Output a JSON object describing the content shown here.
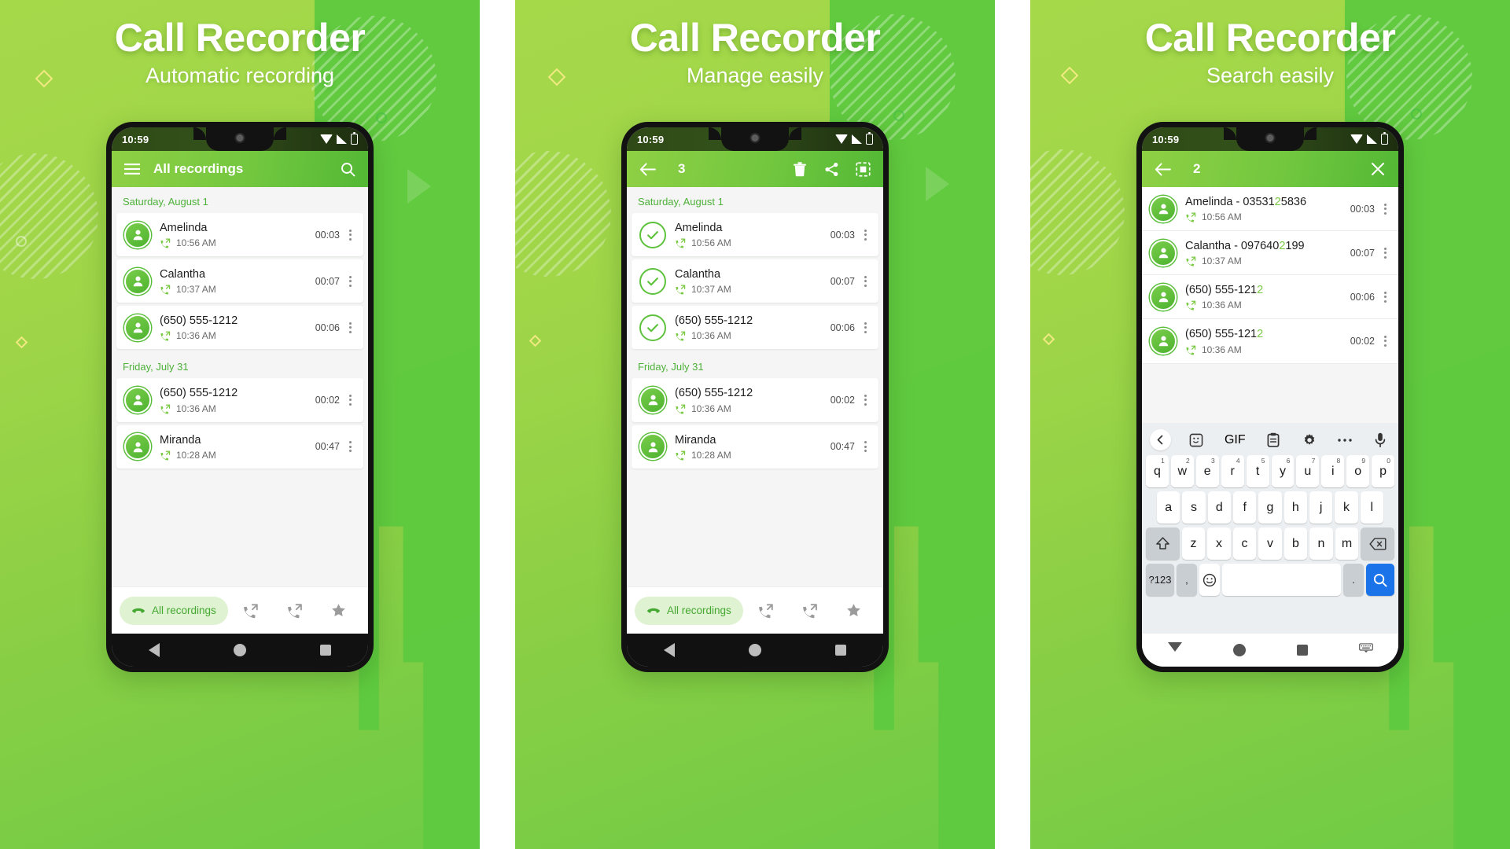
{
  "panels": [
    {
      "heading": "Call Recorder",
      "subheading": "Automatic recording",
      "status": {
        "time": "10:59"
      },
      "appbar": {
        "mode": "normal",
        "title": "All recordings",
        "menu_icon": "hamburger-icon",
        "search_icon": "search-icon"
      },
      "groups": [
        {
          "date": "Saturday, August 1",
          "items": [
            {
              "name": "Amelinda",
              "time": "10:56 AM",
              "duration": "00:03",
              "direction": "outgoing"
            },
            {
              "name": "Calantha",
              "time": "10:37 AM",
              "duration": "00:07",
              "direction": "outgoing"
            },
            {
              "name": "(650) 555-1212",
              "time": "10:36 AM",
              "duration": "00:06",
              "direction": "incoming"
            }
          ]
        },
        {
          "date": "Friday, July 31",
          "items": [
            {
              "name": "(650) 555-1212",
              "time": "10:36 AM",
              "duration": "00:02",
              "direction": "incoming"
            },
            {
              "name": "Miranda",
              "time": "10:28 AM",
              "duration": "00:47",
              "direction": "incoming"
            }
          ]
        }
      ],
      "tabbar": {
        "pill_label": "All recordings",
        "pill_icon": "phone-icon",
        "tabs": [
          "incoming-call-icon",
          "outgoing-call-icon",
          "star-icon"
        ]
      },
      "navbar": "dark"
    },
    {
      "heading": "Call Recorder",
      "subheading": "Manage easily",
      "status": {
        "time": "10:59"
      },
      "appbar": {
        "mode": "selection",
        "title": "3",
        "back_icon": "back-arrow-icon",
        "actions": [
          "delete-icon",
          "share-icon",
          "select-all-icon"
        ]
      },
      "groups": [
        {
          "date": "Saturday, August 1",
          "items": [
            {
              "name": "Amelinda",
              "time": "10:56 AM",
              "duration": "00:03",
              "direction": "outgoing",
              "selected": true
            },
            {
              "name": "Calantha",
              "time": "10:37 AM",
              "duration": "00:07",
              "direction": "outgoing",
              "selected": true
            },
            {
              "name": "(650) 555-1212",
              "time": "10:36 AM",
              "duration": "00:06",
              "direction": "incoming",
              "selected": true
            }
          ]
        },
        {
          "date": "Friday, July 31",
          "items": [
            {
              "name": "(650) 555-1212",
              "time": "10:36 AM",
              "duration": "00:02",
              "direction": "incoming",
              "selected": false
            },
            {
              "name": "Miranda",
              "time": "10:28 AM",
              "duration": "00:47",
              "direction": "incoming",
              "selected": false
            }
          ]
        }
      ],
      "tabbar": {
        "pill_label": "All recordings",
        "pill_icon": "phone-icon",
        "tabs": [
          "incoming-call-icon",
          "outgoing-call-icon",
          "star-icon"
        ]
      },
      "navbar": "dark"
    },
    {
      "heading": "Call Recorder",
      "subheading": "Search easily",
      "status": {
        "time": "10:59"
      },
      "appbar": {
        "mode": "search",
        "title": "2",
        "back_icon": "back-arrow-icon",
        "close_icon": "close-icon"
      },
      "search_query": "2",
      "results": [
        {
          "name_pre": "Amelinda - 03531",
          "name_hl": "2",
          "name_post": "5836",
          "time": "10:56 AM",
          "duration": "00:03",
          "direction": "outgoing"
        },
        {
          "name_pre": "Calantha - 097640",
          "name_hl": "2",
          "name_post": "199",
          "time": "10:37 AM",
          "duration": "00:07",
          "direction": "outgoing"
        },
        {
          "name_pre": "(650) 555-121",
          "name_hl": "2",
          "name_post": "",
          "time": "10:36 AM",
          "duration": "00:06",
          "direction": "incoming"
        },
        {
          "name_pre": "(650) 555-121",
          "name_hl": "2",
          "name_post": "",
          "time": "10:36 AM",
          "duration": "00:02",
          "direction": "incoming"
        }
      ],
      "keyboard": {
        "toolbar": [
          "chevron-left-icon",
          "sticker-icon",
          "gif-label",
          "clipboard-icon",
          "gear-icon",
          "more-icon",
          "microphone-icon"
        ],
        "gif_label": "GIF",
        "row1": [
          {
            "k": "q",
            "n": "1"
          },
          {
            "k": "w",
            "n": "2"
          },
          {
            "k": "e",
            "n": "3"
          },
          {
            "k": "r",
            "n": "4"
          },
          {
            "k": "t",
            "n": "5"
          },
          {
            "k": "y",
            "n": "6"
          },
          {
            "k": "u",
            "n": "7"
          },
          {
            "k": "i",
            "n": "8"
          },
          {
            "k": "o",
            "n": "9"
          },
          {
            "k": "p",
            "n": "0"
          }
        ],
        "row2": [
          "a",
          "s",
          "d",
          "f",
          "g",
          "h",
          "j",
          "k",
          "l"
        ],
        "row3": [
          "z",
          "x",
          "c",
          "v",
          "b",
          "n",
          "m"
        ],
        "shift_icon": "shift-icon",
        "backspace_icon": "backspace-icon",
        "symbols_label": "?123",
        "comma_label": ",",
        "emoji_icon": "emoji-icon",
        "period_label": ".",
        "search_key_icon": "search-icon"
      },
      "navbar": "light"
    }
  ],
  "colors": {
    "brand_green": "#62c53c",
    "accent_light": "#a6d94a",
    "highlight": "#7ac943",
    "pill_bg": "#dff2d1",
    "pill_text": "#45a832",
    "date_text": "#4eb13a",
    "key_blue": "#1a73e8"
  }
}
